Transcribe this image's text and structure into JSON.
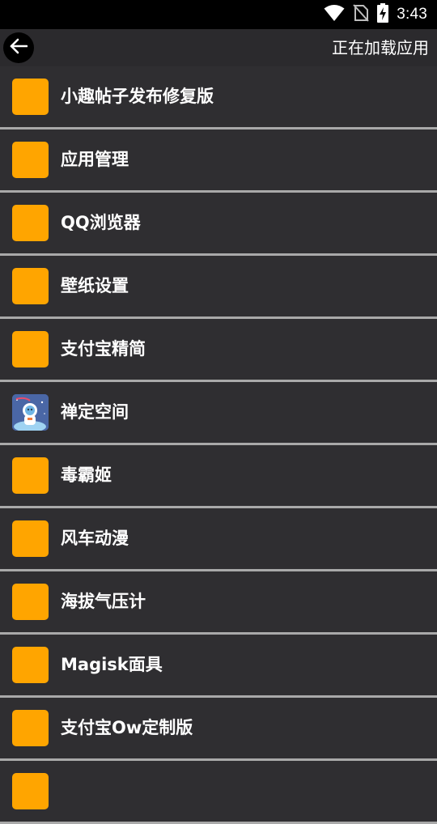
{
  "status_bar": {
    "time": "3:43",
    "icons": [
      "wifi-icon",
      "no-sim-icon",
      "battery-charging-icon"
    ]
  },
  "app_bar": {
    "back_icon": "arrow-left-icon",
    "title": "正在加载应用"
  },
  "apps": [
    {
      "label": "小趣帖子发布修复版",
      "icon": "default-app-icon"
    },
    {
      "label": "应用管理",
      "icon": "default-app-icon"
    },
    {
      "label": "QQ浏览器",
      "icon": "default-app-icon"
    },
    {
      "label": "壁纸设置",
      "icon": "default-app-icon"
    },
    {
      "label": "支付宝精简",
      "icon": "default-app-icon"
    },
    {
      "label": "禅定空间",
      "icon": "astronaut-app-icon"
    },
    {
      "label": "毒霸姬",
      "icon": "default-app-icon"
    },
    {
      "label": "风车动漫",
      "icon": "default-app-icon"
    },
    {
      "label": "海拔气压计",
      "icon": "default-app-icon"
    },
    {
      "label": "Magisk面具",
      "icon": "default-app-icon"
    },
    {
      "label": "支付宝Ow定制版",
      "icon": "default-app-icon"
    },
    {
      "label": "",
      "icon": "default-app-icon"
    }
  ],
  "colors": {
    "accent_icon": "#ffa500",
    "list_background": "#2f2e31",
    "divider": "#a9a9a9",
    "app_bar": "#2b2a2d",
    "status_bar": "#000000"
  }
}
